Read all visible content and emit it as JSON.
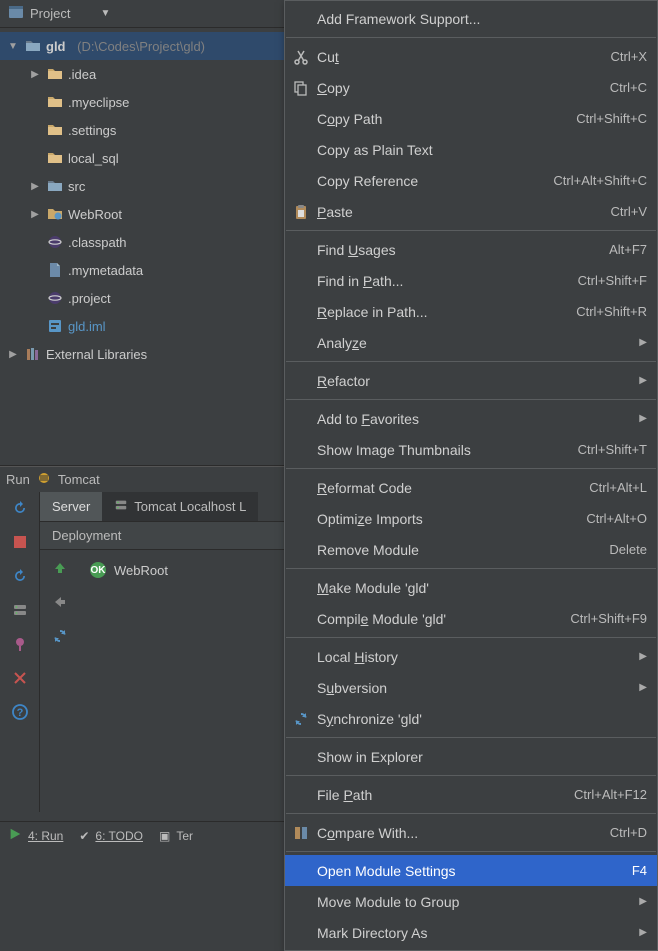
{
  "projectBar": {
    "title": "Project"
  },
  "tree": {
    "root": {
      "name": "gld",
      "path": "(D:\\Codes\\Project\\gld)"
    },
    "children": [
      {
        "name": ".idea",
        "icon": "folder",
        "arrow": true
      },
      {
        "name": ".myeclipse",
        "icon": "folder",
        "arrow": false
      },
      {
        "name": ".settings",
        "icon": "folder",
        "arrow": false
      },
      {
        "name": "local_sql",
        "icon": "folder",
        "arrow": false
      },
      {
        "name": "src",
        "icon": "folder-src",
        "arrow": true
      },
      {
        "name": "WebRoot",
        "icon": "folder-web",
        "arrow": true
      },
      {
        "name": ".classpath",
        "icon": "eclipse",
        "arrow": false
      },
      {
        "name": ".mymetadata",
        "icon": "file",
        "arrow": false
      },
      {
        "name": ".project",
        "icon": "eclipse",
        "arrow": false
      },
      {
        "name": "gld.iml",
        "icon": "iml",
        "arrow": false,
        "highlight": true
      }
    ],
    "external": "External Libraries"
  },
  "run": {
    "header": {
      "label": "Run",
      "config": "Tomcat"
    },
    "tabs": {
      "server": "Server",
      "tomcat": "Tomcat Localhost L"
    },
    "deployment": {
      "header": "Deployment",
      "item": "WebRoot",
      "badge": "OK"
    }
  },
  "status": {
    "run": "4: Run",
    "todo": "6: TODO",
    "terminal": "Ter"
  },
  "menu": {
    "items": [
      {
        "type": "item",
        "label": "Add Framework Support...",
        "icon": ""
      },
      {
        "type": "sep"
      },
      {
        "type": "item",
        "label": "Cut",
        "mnemonic": "t",
        "icon": "cut",
        "shortcut": "Ctrl+X"
      },
      {
        "type": "item",
        "label": "Copy",
        "mnemonic": "C",
        "icon": "copy",
        "shortcut": "Ctrl+C"
      },
      {
        "type": "item",
        "label": "Copy Path",
        "mnemonic": "o",
        "shortcut": "Ctrl+Shift+C"
      },
      {
        "type": "item",
        "label": "Copy as Plain Text"
      },
      {
        "type": "item",
        "label": "Copy Reference",
        "shortcut": "Ctrl+Alt+Shift+C"
      },
      {
        "type": "item",
        "label": "Paste",
        "mnemonic": "P",
        "icon": "paste",
        "shortcut": "Ctrl+V"
      },
      {
        "type": "sep"
      },
      {
        "type": "item",
        "label": "Find Usages",
        "mnemonic": "U",
        "shortcut": "Alt+F7"
      },
      {
        "type": "item",
        "label": "Find in Path...",
        "mnemonic": "P",
        "shortcut": "Ctrl+Shift+F"
      },
      {
        "type": "item",
        "label": "Replace in Path...",
        "mnemonic": "R",
        "shortcut": "Ctrl+Shift+R"
      },
      {
        "type": "item",
        "label": "Analyze",
        "mnemonic": "z",
        "submenu": true
      },
      {
        "type": "sep"
      },
      {
        "type": "item",
        "label": "Refactor",
        "mnemonic": "R",
        "submenu": true
      },
      {
        "type": "sep"
      },
      {
        "type": "item",
        "label": "Add to Favorites",
        "mnemonic": "F",
        "submenu": true
      },
      {
        "type": "item",
        "label": "Show Image Thumbnails",
        "shortcut": "Ctrl+Shift+T"
      },
      {
        "type": "sep"
      },
      {
        "type": "item",
        "label": "Reformat Code",
        "mnemonic": "R",
        "shortcut": "Ctrl+Alt+L"
      },
      {
        "type": "item",
        "label": "Optimize Imports",
        "mnemonic": "z",
        "shortcut": "Ctrl+Alt+O"
      },
      {
        "type": "item",
        "label": "Remove Module",
        "shortcut": "Delete"
      },
      {
        "type": "sep"
      },
      {
        "type": "item",
        "label": "Make Module 'gld'",
        "mnemonic": "M"
      },
      {
        "type": "item",
        "label": "Compile Module 'gld'",
        "mnemonic": "e",
        "shortcut": "Ctrl+Shift+F9"
      },
      {
        "type": "sep"
      },
      {
        "type": "item",
        "label": "Local History",
        "mnemonic": "H",
        "submenu": true
      },
      {
        "type": "item",
        "label": "Subversion",
        "mnemonic": "u",
        "submenu": true
      },
      {
        "type": "item",
        "label": "Synchronize 'gld'",
        "mnemonic": "y",
        "icon": "sync"
      },
      {
        "type": "sep"
      },
      {
        "type": "item",
        "label": "Show in Explorer"
      },
      {
        "type": "sep"
      },
      {
        "type": "item",
        "label": "File Path",
        "mnemonic": "P",
        "shortcut": "Ctrl+Alt+F12"
      },
      {
        "type": "sep"
      },
      {
        "type": "item",
        "label": "Compare With...",
        "mnemonic": "o",
        "icon": "compare",
        "shortcut": "Ctrl+D"
      },
      {
        "type": "sep"
      },
      {
        "type": "item",
        "label": "Open Module Settings",
        "shortcut": "F4",
        "highlighted": true
      },
      {
        "type": "item",
        "label": "Move Module to Group",
        "submenu": true
      },
      {
        "type": "item",
        "label": "Mark Directory As",
        "submenu": true
      }
    ]
  }
}
